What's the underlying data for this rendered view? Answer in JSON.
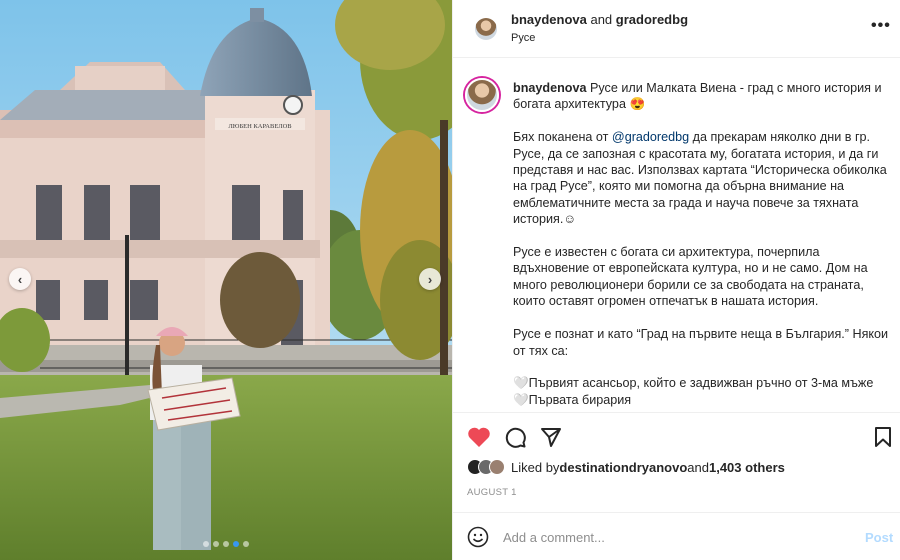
{
  "header": {
    "author": "bnaydenova",
    "connector": " and ",
    "collaborator": "gradoredbg",
    "location": "Русе",
    "more_icon": "more-horizontal-icon"
  },
  "media": {
    "carousel_dots": 5,
    "active_dot": 3,
    "building_sign": "ЛЮБЕН КАРАВЕЛОВ",
    "prev_icon": "chevron-left-icon",
    "next_icon": "chevron-right-icon"
  },
  "caption": {
    "author": "bnaydenova",
    "intro": " Русе или Малката Виена - град с много история и богата архитектура 😍",
    "p1_before": "Бях поканена от ",
    "p1_mention": "@gradoredbg",
    "p1_after": " да прекарам няколко дни в гр. Русе, да се запозная с красотата му, богатата история, и да ги представя и нас вас. Използвах картата “Историческа обиколка на град Русе”, която ми помогна да обърна внимание на емблематичните места за града и науча повече за тяхната история.☺",
    "p2": "Русе е известен с богата си архитектура, почерпила вдъхновение от европейската култура, но и не само. Дом на много революционери борили се за свободата на страната, които оставят огромен отпечатък в нашата история.",
    "p3": "Русе е познат и като “Град на първите неща в България.” Някои от тях са:",
    "l1": "🤍Първият асансьор, който е задвижван ръчно от 3-ма мъже",
    "l2": "🤍Първата бирария"
  },
  "actions": {
    "liked": true,
    "like_color": "#ed4956",
    "icons": [
      "heart-icon",
      "comment-icon",
      "share-icon",
      "bookmark-icon"
    ]
  },
  "likes": {
    "prefix": "Liked by ",
    "user": "destinationdryanovo",
    "middle": " and ",
    "count": "1,403 others"
  },
  "date": "AUGUST 1",
  "comment": {
    "placeholder": "Add a comment...",
    "post_label": "Post",
    "emoji_icon": "smiley-icon"
  }
}
